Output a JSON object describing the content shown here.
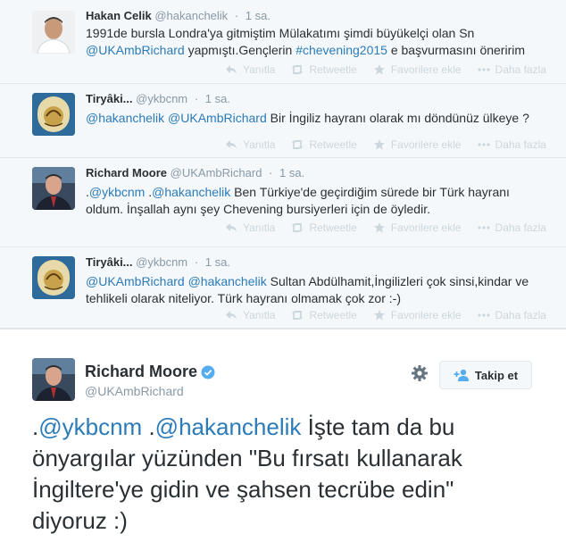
{
  "tweets": [
    {
      "fullname": "Hakan Celik",
      "username": "@hakanchelik",
      "time": "1 sa.",
      "line1": "1991de bursla Londra'ya gitmiştim Mülakatımı şimdi büyükelçi olan Sn",
      "line2_mention": "@UKAmbRichard",
      "line2_text": " yapmıştı.Gençlerin ",
      "line2_hashtag": "#chevening2015",
      "line2_tail": " e başvurmasını öneririm"
    },
    {
      "fullname": "Tiryâki...",
      "username": "@ykbcnm",
      "time": "1 sa.",
      "mention1": "@hakanchelik",
      "mention2": "@UKAmbRichard",
      "text": " Bir İngiliz hayranı olarak mı döndünüz ülkeye ?"
    },
    {
      "fullname": "Richard Moore",
      "username": "@UKAmbRichard",
      "time": "1 sa.",
      "prefix": ".",
      "mention1": "@ykbcnm",
      "mention2": "@hakanchelik",
      "line1_text": " Ben Türkiye'de geçirdiğim sürede bir Türk hayranı",
      "line2": "oldum. İnşallah aynı şey Chevening bursiyerleri için de öyledir."
    },
    {
      "fullname": "Tiryâki...",
      "username": "@ykbcnm",
      "time": "1 sa.",
      "mention1": "@UKAmbRichard",
      "mention2": "@hakanchelik",
      "line1_text": " Sultan Abdülhamit,İngilizleri çok sinsi,kindar ve",
      "line2": "tehlikeli olarak niteliyor. Türk hayranı olmamak çok zor :-)"
    }
  ],
  "actions": {
    "reply": "Yanıtla",
    "retweet": "Retweetle",
    "favorite": "Favorilere ekle",
    "more": "Daha fazla"
  },
  "main_tweet": {
    "fullname": "Richard Moore",
    "username": "@UKAmbRichard",
    "follow_label": "Takip et",
    "prefix1": ".",
    "mention1": "@ykbcnm",
    "prefix2": " .",
    "mention2": "@hakanchelik",
    "line1_text": " İşte tam da bu",
    "line2": "önyargılar yüzünden \"Bu fırsatı kullanarak",
    "line3": "İngiltere'ye gidin ve şahsen tecrübe edin\"",
    "line4": "diyoruz :)"
  },
  "colors": {
    "link": "#2b7bb9",
    "verified": "#55acee",
    "muted": "#8899a6"
  }
}
